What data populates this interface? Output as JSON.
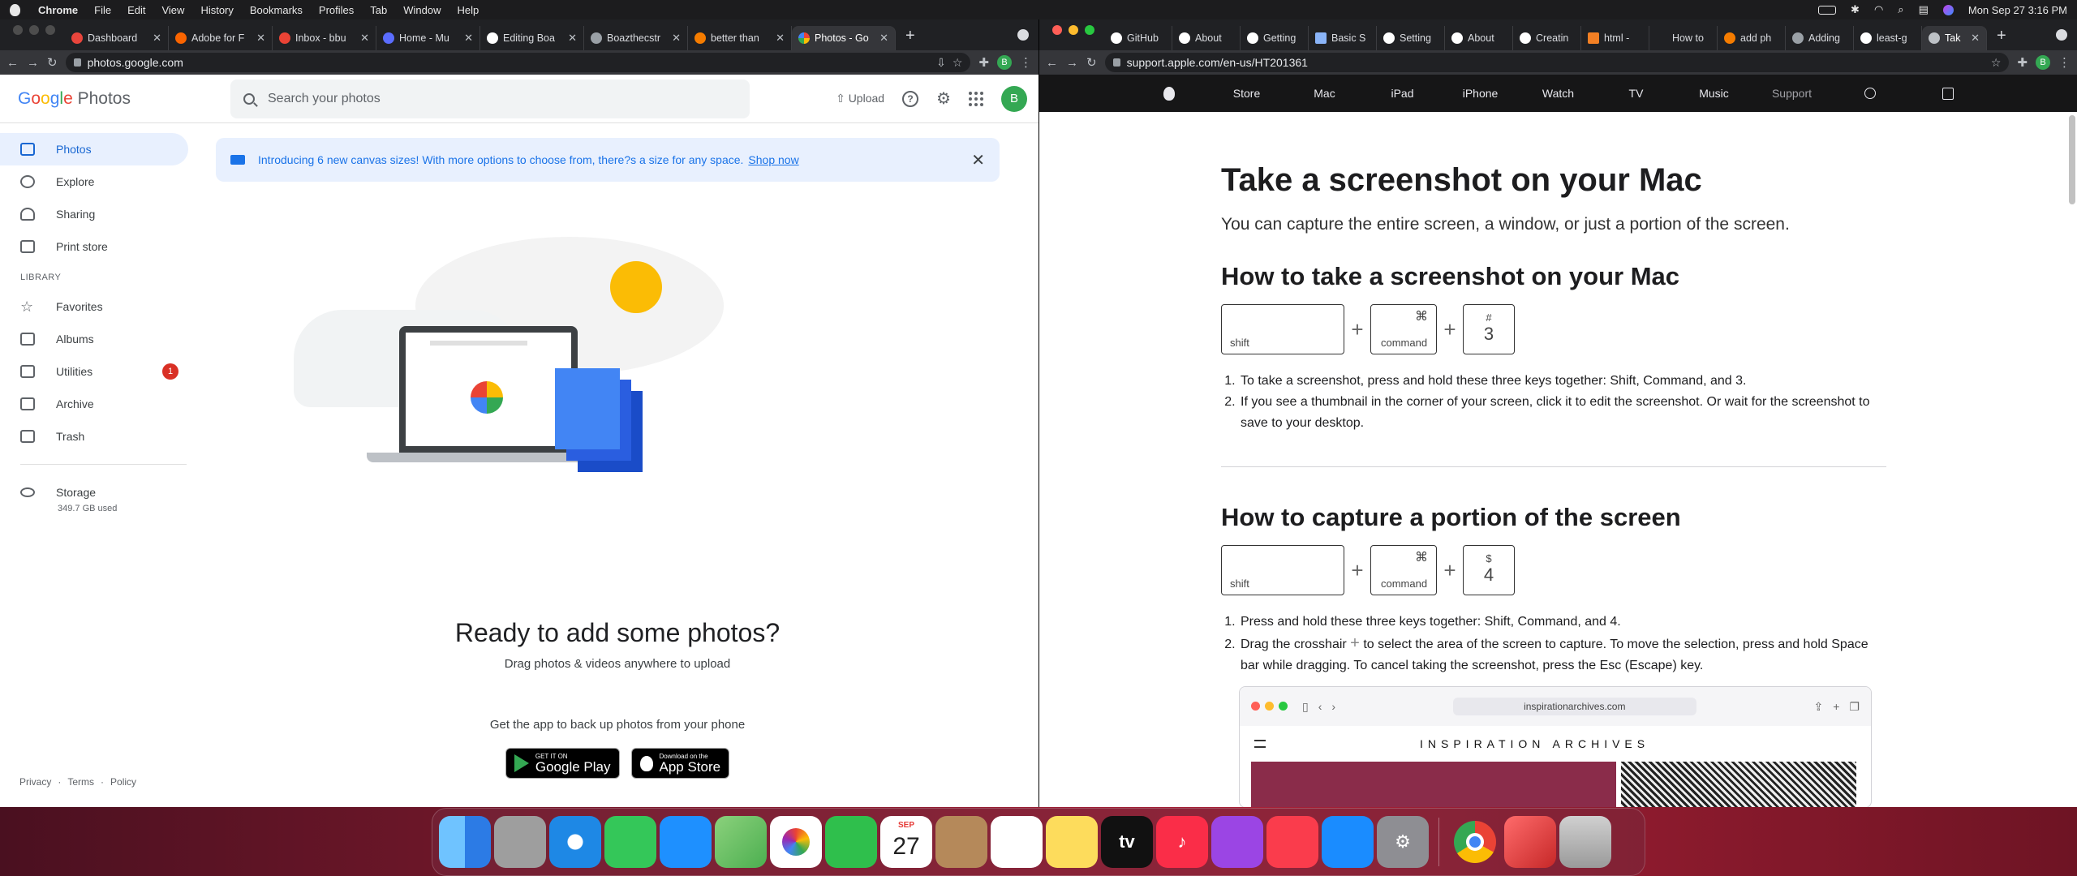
{
  "menubar": {
    "app_name": "Chrome",
    "menus": [
      "File",
      "Edit",
      "View",
      "History",
      "Bookmarks",
      "Profiles",
      "Tab",
      "Window",
      "Help"
    ],
    "clock": "Mon Sep 27  3:16 PM"
  },
  "left_window": {
    "tabs": [
      {
        "title": "Dashboard",
        "color": "#e8453c"
      },
      {
        "title": "Adobe for F",
        "color": "#fa6400"
      },
      {
        "title": "Inbox - bbu",
        "color": "#ea4335"
      },
      {
        "title": "Home - Mu",
        "color": "#5b6dff"
      },
      {
        "title": "Editing Boa",
        "color": "#ffffff"
      },
      {
        "title": "Boazthecstr",
        "color": "#9aa0a6"
      },
      {
        "title": "better than",
        "color": "#f57c00"
      },
      {
        "title": "Photos - Go",
        "color": "#fbbc05",
        "active": true
      }
    ],
    "url": "photos.google.com",
    "profile_initial": "B"
  },
  "google_photos": {
    "logo_letters": [
      "G",
      "o",
      "o",
      "g",
      "l",
      "e"
    ],
    "logo_suffix": "Photos",
    "search_placeholder": "Search your photos",
    "upload_label": "Upload",
    "help_glyph": "?",
    "avatar_initial": "B",
    "nav": [
      {
        "label": "Photos",
        "icon": "photo-icon",
        "active": true
      },
      {
        "label": "Explore",
        "icon": "search-icon"
      },
      {
        "label": "Sharing",
        "icon": "people-icon"
      },
      {
        "label": "Print store",
        "icon": "print-store-icon"
      }
    ],
    "library_heading": "LIBRARY",
    "library": [
      {
        "label": "Favorites",
        "icon": "star-icon"
      },
      {
        "label": "Albums",
        "icon": "album-icon"
      },
      {
        "label": "Utilities",
        "icon": "utilities-icon",
        "badge": "1"
      },
      {
        "label": "Archive",
        "icon": "archive-icon"
      },
      {
        "label": "Trash",
        "icon": "trash-icon"
      }
    ],
    "storage_label": "Storage",
    "storage_used": "349.7 GB used",
    "banner_text": "Introducing 6 new canvas sizes! With more options to choose from, there?s a size for any space.",
    "banner_link": "Shop now",
    "empty_title": "Ready to add some photos?",
    "empty_sub": "Drag photos & videos anywhere to upload",
    "app_prompt": "Get the app to back up photos from your phone",
    "play_small": "GET IT ON",
    "play_big": "Google Play",
    "appstore_small": "Download on the",
    "appstore_big": "App Store",
    "footer": [
      "Privacy",
      "·",
      "Terms",
      "·",
      "Policy"
    ]
  },
  "right_window": {
    "tabs": [
      {
        "title": "GitHub",
        "color": "#ffffff"
      },
      {
        "title": "About",
        "color": "#ffffff"
      },
      {
        "title": "Getting",
        "color": "#ffffff"
      },
      {
        "title": "Basic S",
        "color": "#8ab4f8"
      },
      {
        "title": "Setting",
        "color": "#ffffff"
      },
      {
        "title": "About",
        "color": "#ffffff"
      },
      {
        "title": "Creatin",
        "color": "#ffffff"
      },
      {
        "title": "html -",
        "color": "#f48024"
      },
      {
        "title": "How to",
        "color": "#9aa0a6"
      },
      {
        "title": "add ph",
        "color": "#f57c00"
      },
      {
        "title": "Adding",
        "color": "#9aa0a6"
      },
      {
        "title": "least-g",
        "color": "#ffffff"
      },
      {
        "title": "Tak",
        "color": "#bdc1c6",
        "active": true
      }
    ],
    "url": "support.apple.com/en-us/HT201361",
    "profile_initial": "B"
  },
  "apple_support": {
    "nav": [
      "Store",
      "Mac",
      "iPad",
      "iPhone",
      "Watch",
      "TV",
      "Music",
      "Support"
    ],
    "h1": "Take a screenshot on your Mac",
    "intro": "You can capture the entire screen, a window, or just a portion of the screen.",
    "section1": {
      "heading": "How to take a screenshot on your Mac",
      "keys": {
        "shift": "shift",
        "cmd_sym": "⌘",
        "cmd": "command",
        "num_top": "#",
        "num": "3"
      },
      "steps": [
        "To take a screenshot, press and hold these three keys together: Shift, Command, and 3.",
        "If you see a thumbnail in the corner of your screen, click it to edit the screenshot. Or wait for the screenshot to save to your desktop."
      ]
    },
    "section2": {
      "heading": "How to capture a portion of the screen",
      "keys": {
        "shift": "shift",
        "cmd_sym": "⌘",
        "cmd": "command",
        "num_top": "$",
        "num": "4"
      },
      "step1": "Press and hold these three keys together: Shift, Command, and 4.",
      "step2_a": "Drag the crosshair",
      "step2_b": "to select the area of the screen to capture. To move the selection, press and hold Space bar while dragging. To cancel taking the screenshot, press the Esc (Escape) key."
    },
    "example": {
      "url": "inspirationarchives.com",
      "site_title": "INSPIRATION ARCHIVES"
    }
  },
  "dock": {
    "calendar_month": "SEP",
    "calendar_day": "27",
    "tv_label": "tv",
    "apps": [
      {
        "name": "finder-icon",
        "color": "#3b8df2"
      },
      {
        "name": "launchpad-icon",
        "color": "#9e9e9e"
      },
      {
        "name": "safari-icon",
        "color": "#1e88e5"
      },
      {
        "name": "messages-icon",
        "color": "#34c759"
      },
      {
        "name": "mail-icon",
        "color": "#1e90ff"
      },
      {
        "name": "maps-icon",
        "color": "#4caf50"
      },
      {
        "name": "photos-icon",
        "color": "#ffffff"
      },
      {
        "name": "facetime-icon",
        "color": "#2fbf4c"
      },
      {
        "name": "calendar-icon",
        "color": "#ffffff"
      },
      {
        "name": "contacts-icon",
        "color": "#b5895a"
      },
      {
        "name": "reminders-icon",
        "color": "#ffffff"
      },
      {
        "name": "notes-icon",
        "color": "#fddc5c"
      },
      {
        "name": "apple-tv-icon",
        "color": "#111111"
      },
      {
        "name": "music-icon",
        "color": "#fa2d48"
      },
      {
        "name": "podcasts-icon",
        "color": "#9b45e4"
      },
      {
        "name": "news-icon",
        "color": "#fa3c4c"
      },
      {
        "name": "app-store-icon",
        "color": "#1a8cff"
      },
      {
        "name": "system-preferences-icon",
        "color": "#8e8e93"
      },
      {
        "name": "chrome-icon",
        "color": "#ffffff"
      },
      {
        "name": "pdf-app-icon",
        "color": "#e53935"
      },
      {
        "name": "trash-icon",
        "color": "#a0a0a0"
      }
    ]
  }
}
